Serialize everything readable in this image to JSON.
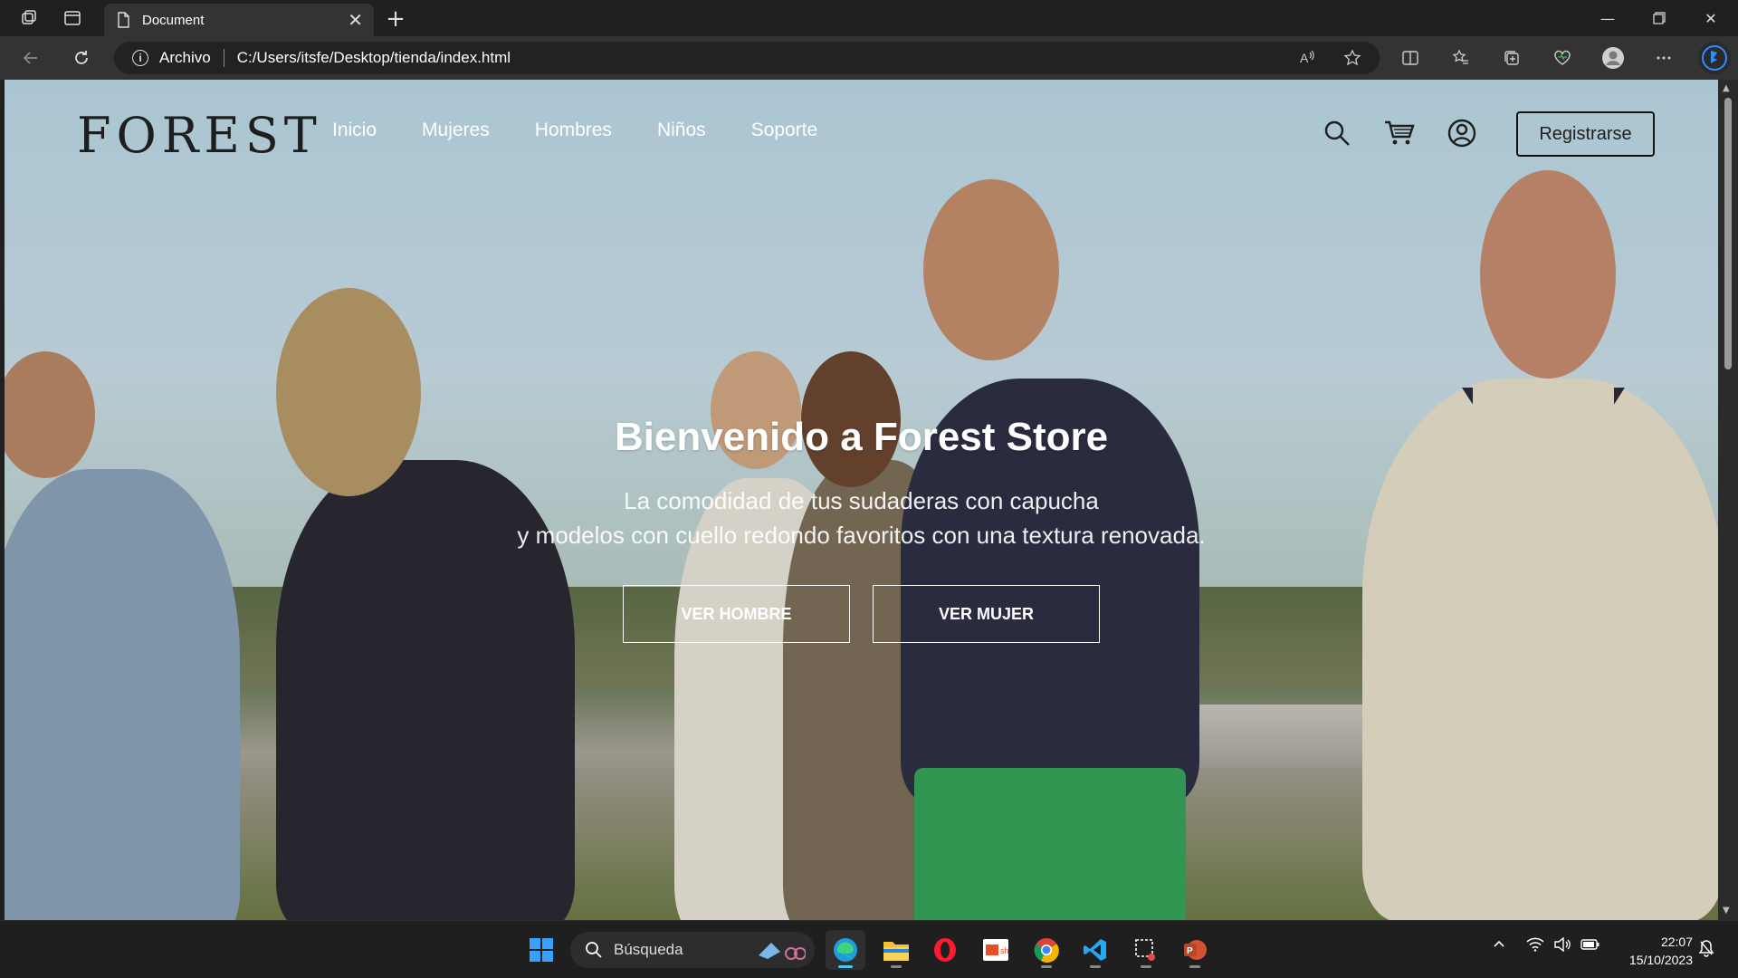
{
  "browser": {
    "tab_title": "Document",
    "address_protocol": "Archivo",
    "address_url": "C:/Users/itsfe/Desktop/tienda/index.html"
  },
  "site": {
    "logo": "FOREST",
    "menu": [
      "Inicio",
      "Mujeres",
      "Hombres",
      "Niños",
      "Soporte"
    ],
    "register_label": "Registrarse",
    "hero_title": "Bienvenido a Forest Store",
    "hero_sub_line1": "La comodidad de tus sudaderas con capucha",
    "hero_sub_line2": "y modelos con cuello redondo favoritos con una textura renovada.",
    "btn_men": "VER HOMBRE",
    "btn_women": "VER MUJER"
  },
  "taskbar": {
    "search_label": "Búsqueda",
    "time": "22:07",
    "date": "15/10/2023"
  },
  "colors": {
    "accent": "#4cc2ff",
    "chrome_dark": "#202020",
    "chrome_mid": "#333333",
    "logo_text": "#1e1e1e"
  }
}
